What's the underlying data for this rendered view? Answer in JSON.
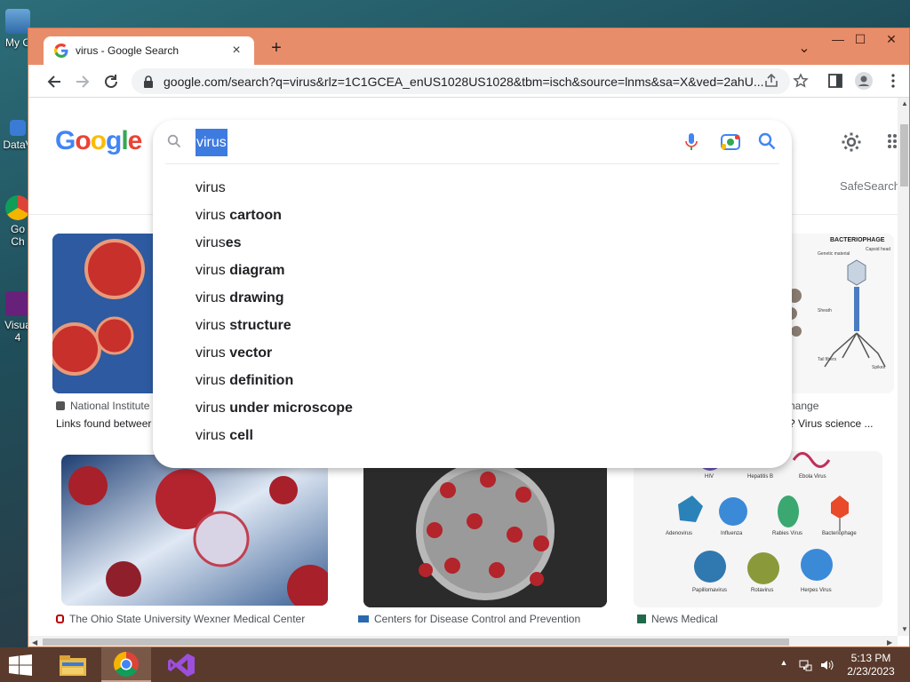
{
  "desktop": {
    "icons": [
      {
        "label": "My C",
        "icon": "computer-icon"
      },
      {
        "label": "DataV",
        "icon": "shortcut-icon"
      },
      {
        "label": "Go\nCh",
        "icon": "chrome-shortcut-icon"
      },
      {
        "label": "Visua\n4",
        "icon": "visual-studio-shortcut-icon"
      }
    ]
  },
  "browser": {
    "tab": {
      "title": "virus - Google Search",
      "close": "×"
    },
    "new_tab": "+",
    "window_controls": {
      "dropdown": "⌄",
      "minimize": "—",
      "maximize": "☐",
      "close": "✕"
    },
    "address": "google.com/search?q=virus&rlz=1C1GCEA_enUS1028US1028&tbm=isch&source=lnms&sa=X&ved=2ahU..."
  },
  "colors": {
    "titlebar": "#e88d6a",
    "selection": "#3e7be0",
    "taskbar": "#5a3a2c"
  },
  "google": {
    "logo": [
      "G",
      "o",
      "o",
      "g",
      "l",
      "e"
    ],
    "safesearch": "SafeSearch",
    "search": {
      "query": "virus",
      "suggestions": [
        {
          "base": "virus",
          "bold": ""
        },
        {
          "base": "virus ",
          "bold": "cartoon"
        },
        {
          "base": "virus",
          "bold": "es"
        },
        {
          "base": "virus ",
          "bold": "diagram"
        },
        {
          "base": "virus ",
          "bold": "drawing"
        },
        {
          "base": "virus ",
          "bold": "structure"
        },
        {
          "base": "virus ",
          "bold": "vector"
        },
        {
          "base": "virus ",
          "bold": "definition"
        },
        {
          "base": "virus ",
          "bold": "under microscope"
        },
        {
          "base": "virus ",
          "bold": "cell"
        }
      ]
    },
    "results": [
      {
        "source": "National Institute",
        "caption": "Links found betweer"
      },
      {
        "source": "hange",
        "caption": "? Virus science ..."
      },
      {
        "source": "The Ohio State University Wexner Medical Center",
        "caption": ""
      },
      {
        "source": "Centers for Disease Control and Prevention",
        "caption": ""
      },
      {
        "source": "News Medical",
        "caption": ""
      }
    ],
    "bacteriophage_diagram": {
      "title": "BACTERIOPHAGE",
      "labels": [
        "Genetic material",
        "Capsid head",
        "Sheath",
        "Tail fibers",
        "Spikes"
      ]
    },
    "virus_types_diagram": {
      "labels": [
        "HIV",
        "Hepatitis B",
        "Ebola Virus",
        "Adenovirus",
        "Influenza",
        "Rabies Virus",
        "Bacteriophage",
        "Papillomavirus",
        "Rotavirus",
        "Herpes Virus"
      ]
    }
  },
  "taskbar": {
    "apps": [
      {
        "name": "File Explorer",
        "icon": "file-explorer-icon"
      },
      {
        "name": "Google Chrome",
        "icon": "chrome-icon"
      },
      {
        "name": "Visual Studio",
        "icon": "visual-studio-icon"
      }
    ],
    "clock": {
      "time": "5:13 PM",
      "date": "2/23/2023"
    }
  }
}
